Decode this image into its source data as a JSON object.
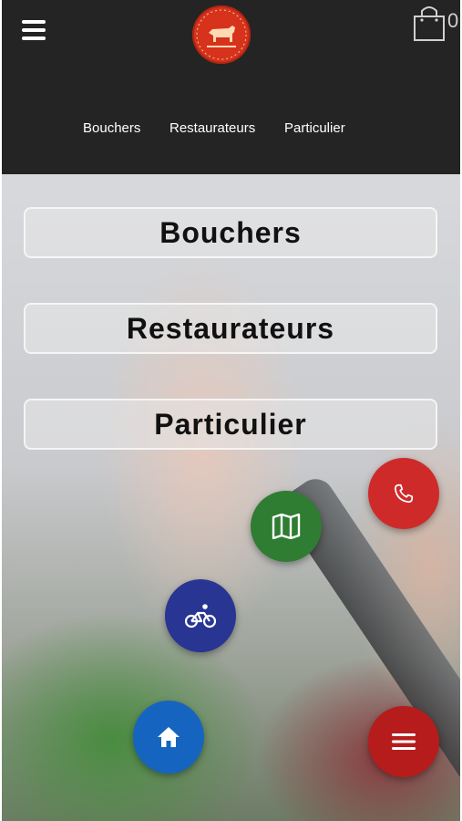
{
  "header": {
    "cart_count": "0",
    "nav": [
      {
        "label": "Bouchers"
      },
      {
        "label": "Restaurateurs"
      },
      {
        "label": "Particulier"
      }
    ]
  },
  "main": {
    "categories": [
      {
        "label": "Bouchers"
      },
      {
        "label": "Restaurateurs"
      },
      {
        "label": "Particulier"
      }
    ]
  },
  "fab": {
    "phone": {
      "icon": "phone-icon",
      "color": "#cf2a2a"
    },
    "map": {
      "icon": "map-icon",
      "color": "#2e7d32"
    },
    "delivery": {
      "icon": "bicycle-icon",
      "color": "#283593"
    },
    "home": {
      "icon": "home-icon",
      "color": "#1565c0"
    },
    "menu": {
      "icon": "menu-icon",
      "color": "#b71c1c"
    }
  },
  "colors": {
    "header_bg": "#242424",
    "logo_red": "#d6321c"
  }
}
